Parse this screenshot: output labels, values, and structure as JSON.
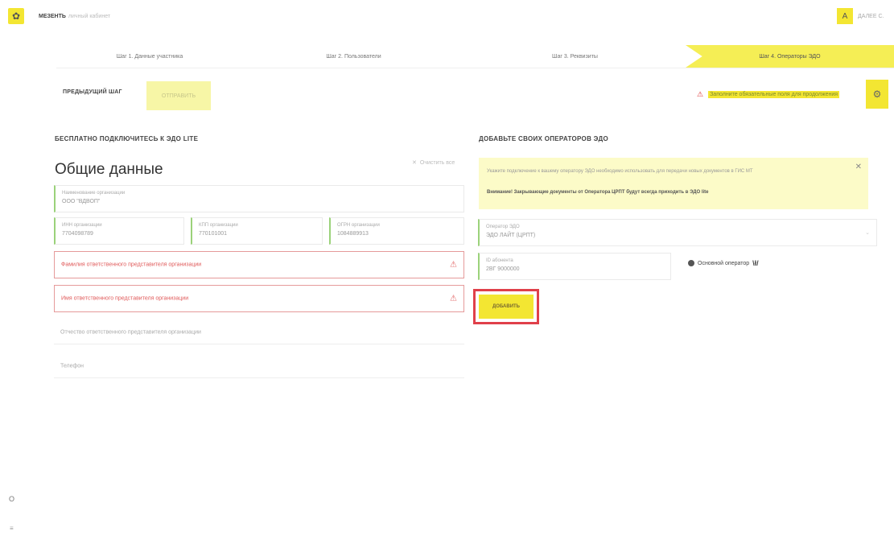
{
  "header": {
    "brand": "МЕЗЕНТЬ",
    "brand_sub": "личный кабинет",
    "logo_icon": "✿",
    "user_initial": "А",
    "user_name": "ДАЛЕЕ С."
  },
  "steps": [
    {
      "label": "Шаг 1. Данные участника"
    },
    {
      "label": "Шаг 2. Пользователи"
    },
    {
      "label": "Шаг 3. Реквизиты"
    },
    {
      "label": "Шаг 4. Операторы ЭДО",
      "active": true
    }
  ],
  "actions": {
    "prev_label": "ПРЕДЫДУЩИЙ ШАГ",
    "send_label": "ОТПРАВИТЬ",
    "warning_text": "Заполните обязательные поля для продолжения",
    "warning_icon": "⚠",
    "settings_icon": "⚙"
  },
  "left": {
    "section_title": "БЕСПЛАТНО ПОДКЛЮЧИТЕСЬ К ЭДО LITE",
    "title": "Общие данные",
    "clear_label": "Очистить все",
    "fields": {
      "org_label": "Наименование организации",
      "org_value": "ООО \"ВДВОП\"",
      "inn_label": "ИНН организации",
      "inn_value": "7704098789",
      "kpp_label": "КПП организации",
      "kpp_value": "770101001",
      "ogrn_label": "ОГРН организации",
      "ogrn_value": "1084889913",
      "surname_ph": "Фамилия ответственного представителя организации",
      "name_ph": "Имя ответственного представителя организации",
      "patronymic_ph": "Отчество ответственного представителя организации",
      "phone_ph": "Телефон"
    }
  },
  "right": {
    "section_title": "ДОБАВЬТЕ СВОИХ ОПЕРАТОРОВ ЭДО",
    "notice_text": "Укажите подключение к вашему оператору ЭДО необходимо использовать для передачи новых документов в ГИС МТ",
    "notice_warning": "Внимание! Закрывающие документы от Оператора ЦРПТ будут всегда приходить в ЭДО lite",
    "operator_label": "Оператор ЭДО",
    "operator_value": "ЭДО ЛАЙТ (ЦРПТ)",
    "id_label": "ID абонента",
    "id_value": "2ВГ 9000000",
    "main_op_label": "Основной оператор",
    "main_op_ref": "\\ł/",
    "add_label": "ДОБАВИТЬ"
  },
  "side": {
    "icon1": "O",
    "icon2": "≡"
  },
  "colors": {
    "accent": "#f3e632",
    "accent_light": "#f7f6a6",
    "notice_bg": "#fcfbc8",
    "error": "#e05b5b",
    "highlight": "#e0404a"
  }
}
